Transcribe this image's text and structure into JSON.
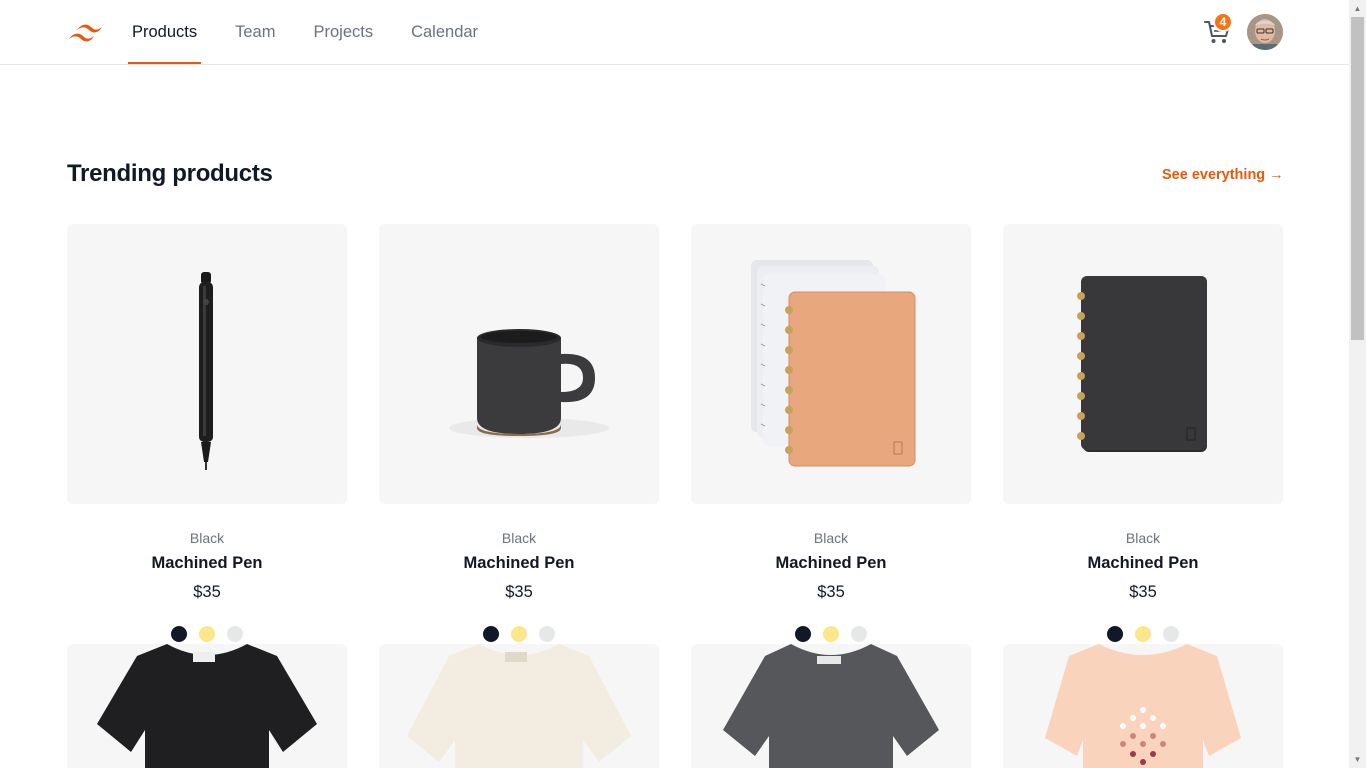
{
  "header": {
    "nav": [
      {
        "label": "Products",
        "active": true
      },
      {
        "label": "Team",
        "active": false
      },
      {
        "label": "Projects",
        "active": false
      },
      {
        "label": "Calendar",
        "active": false
      }
    ],
    "cart_count": "4",
    "brand_color": "#ea580c"
  },
  "section": {
    "title": "Trending products",
    "see_all": "See everything →"
  },
  "products": [
    {
      "color": "Black",
      "name": "Machined Pen",
      "price": "$35",
      "image": "pen"
    },
    {
      "color": "Black",
      "name": "Machined Pen",
      "price": "$35",
      "image": "mug"
    },
    {
      "color": "Black",
      "name": "Machined Pen",
      "price": "$35",
      "image": "notebook-tan"
    },
    {
      "color": "Black",
      "name": "Machined Pen",
      "price": "$35",
      "image": "notebook-black"
    }
  ],
  "swatches": [
    "#111827",
    "#fde68a",
    "#e5e7eb"
  ],
  "shirts": [
    "black",
    "cream",
    "charcoal",
    "peach"
  ]
}
